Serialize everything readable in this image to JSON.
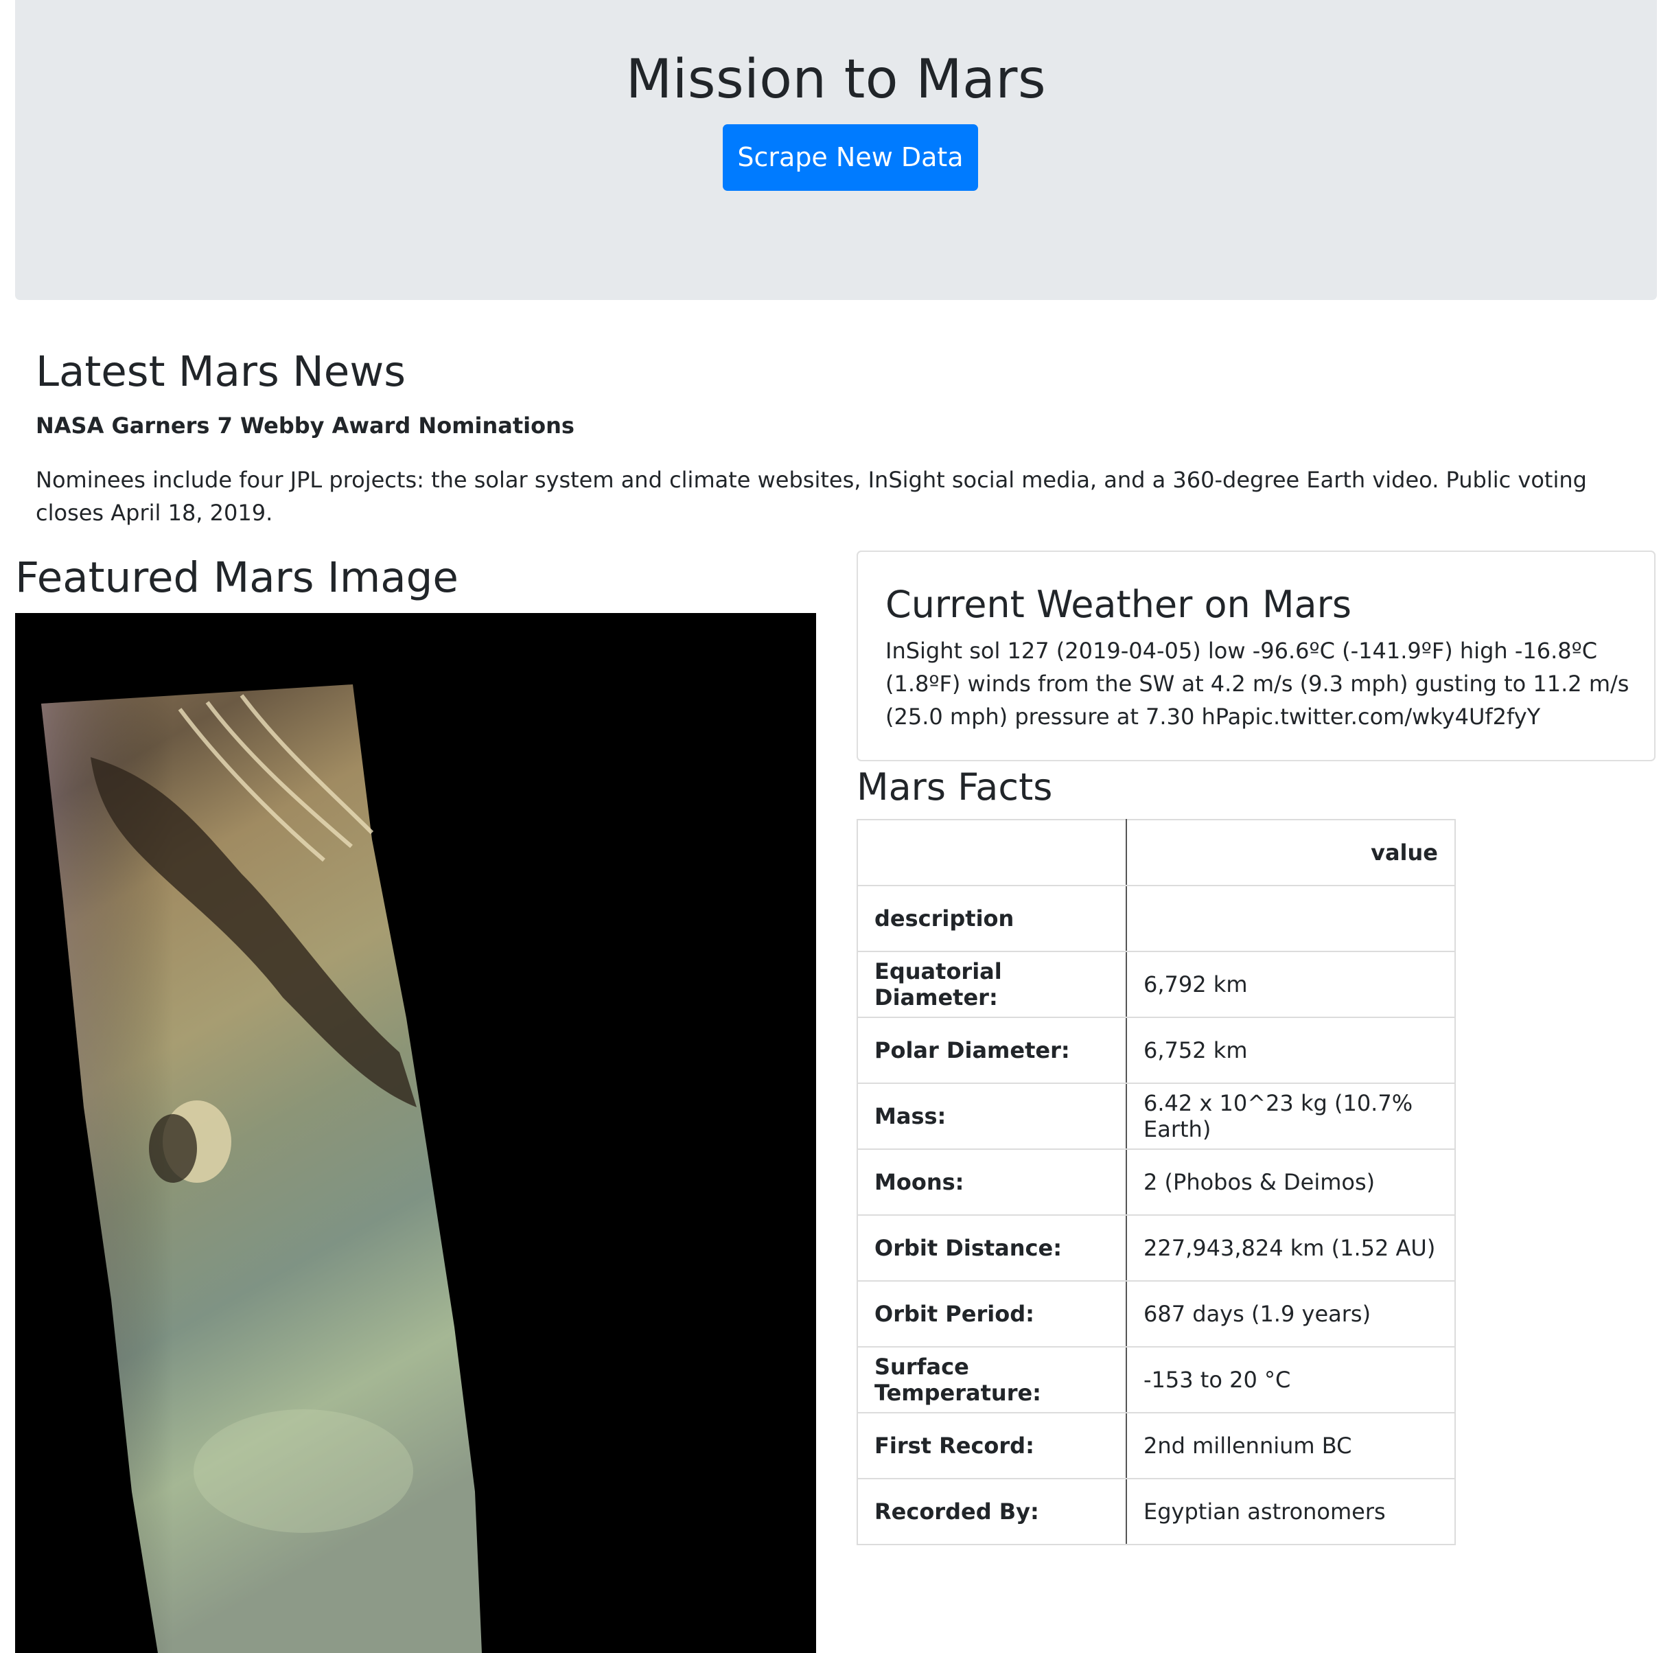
{
  "header": {
    "title": "Mission to Mars",
    "scrape_button": "Scrape New Data"
  },
  "news": {
    "heading": "Latest Mars News",
    "title": "NASA Garners 7 Webby Award Nominations",
    "teaser": "Nominees include four JPL projects: the solar system and climate websites, InSight social media, and a 360-degree Earth video. Public voting closes April 18, 2019."
  },
  "featured": {
    "heading": "Featured Mars Image",
    "image_alt": "Featured Mars image: false-color orbital strip of Martian terrain"
  },
  "weather": {
    "heading": "Current Weather on Mars",
    "text": "InSight sol 127 (2019-04-05) low -96.6ºC (-141.9ºF) high -16.8ºC (1.8ºF) winds from the SW at 4.2 m/s (9.3 mph) gusting to 11.2 m/s (25.0 mph) pressure at 7.30 hPapic.twitter.com/wky4Uf2fyY"
  },
  "facts": {
    "heading": "Mars Facts",
    "value_header": "value",
    "index_header": "description",
    "rows": [
      {
        "label": "Equatorial Diameter:",
        "value": "6,792 km"
      },
      {
        "label": "Polar Diameter:",
        "value": "6,752 km"
      },
      {
        "label": "Mass:",
        "value": "6.42 x 10^23 kg (10.7% Earth)"
      },
      {
        "label": "Moons:",
        "value": "2 (Phobos & Deimos)"
      },
      {
        "label": "Orbit Distance:",
        "value": "227,943,824 km (1.52 AU)"
      },
      {
        "label": "Orbit Period:",
        "value": "687 days (1.9 years)"
      },
      {
        "label": "Surface Temperature:",
        "value": "-153 to 20 °C"
      },
      {
        "label": "First Record:",
        "value": "2nd millennium BC"
      },
      {
        "label": "Recorded By:",
        "value": "Egyptian astronomers"
      }
    ]
  },
  "colors": {
    "jumbotron_bg": "#e6e9ec",
    "button_bg": "#007bff",
    "text": "#212529"
  }
}
